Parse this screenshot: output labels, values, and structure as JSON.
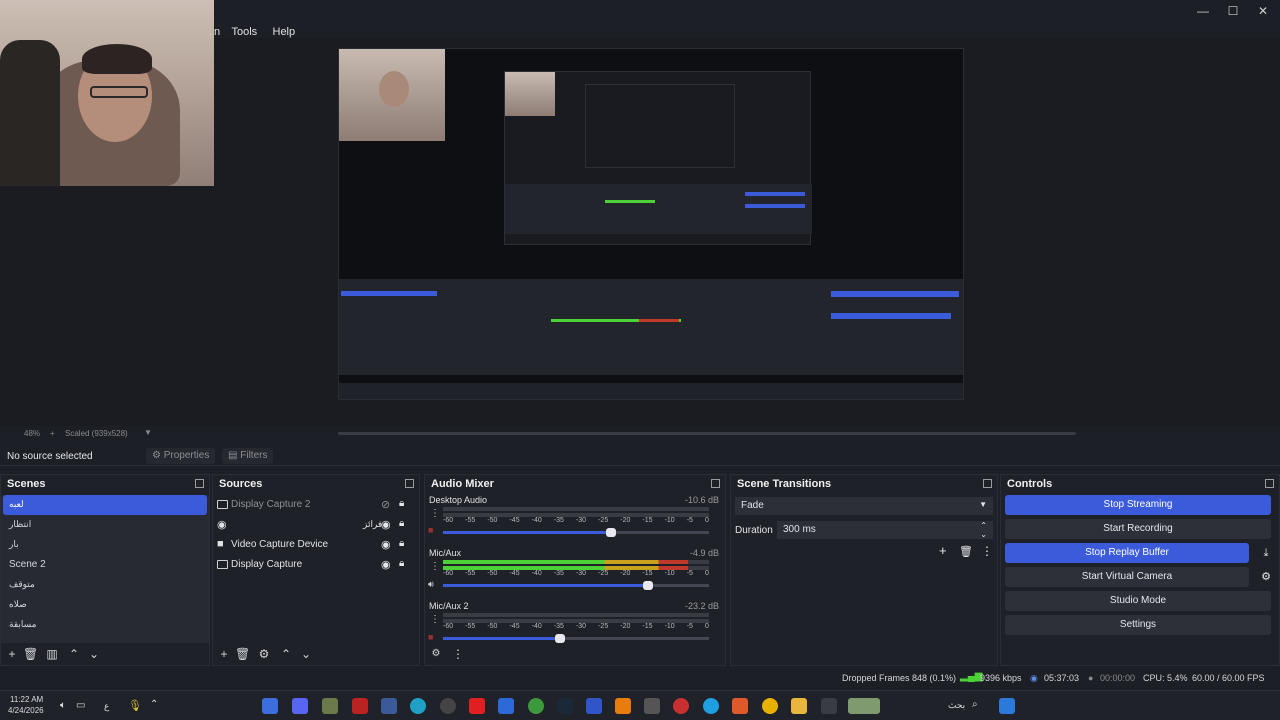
{
  "menu": {
    "tools": "Tools",
    "help": "Help",
    "partial": "n"
  },
  "window_controls": {
    "minimize": "—",
    "maximize": "☐",
    "close": "✕"
  },
  "preview": {
    "zoom": "48%",
    "scale_label": "Scaled (939x528)"
  },
  "source_toolbar": {
    "no_source": "No source selected",
    "properties": "Properties",
    "filters": "Filters"
  },
  "scenes": {
    "title": "Scenes",
    "items": [
      {
        "label": "لعبه",
        "selected": true
      },
      {
        "label": "انتظار",
        "selected": false
      },
      {
        "label": "بار",
        "selected": false
      },
      {
        "label": "Scene 2",
        "selected": false
      },
      {
        "label": "متوقف",
        "selected": false
      },
      {
        "label": "صلاه",
        "selected": false
      },
      {
        "label": "مسابقة",
        "selected": false
      }
    ]
  },
  "sources": {
    "title": "Sources",
    "items": [
      {
        "label": "Display Capture 2",
        "dimmed": true
      },
      {
        "label": "فرائز",
        "dimmed": false
      },
      {
        "label": "Video Capture Device",
        "dimmed": false
      },
      {
        "label": "Display Capture",
        "dimmed": false
      }
    ]
  },
  "audio_mixer": {
    "title": "Audio Mixer",
    "scale": [
      "-60",
      "-55",
      "-50",
      "-45",
      "-40",
      "-35",
      "-30",
      "-25",
      "-20",
      "-15",
      "-10",
      "-5",
      "0"
    ],
    "channels": [
      {
        "name": "Desktop Audio",
        "db": "-10.6 dB",
        "level": 0.0,
        "volume": 0.63
      },
      {
        "name": "Mic/Aux",
        "db": "-4.9 dB",
        "level": 0.92,
        "volume": 0.77
      },
      {
        "name": "Mic/Aux 2",
        "db": "-23.2 dB",
        "level": 0.0,
        "volume": 0.44
      }
    ]
  },
  "scene_transitions": {
    "title": "Scene Transitions",
    "transition": "Fade",
    "duration_label": "Duration",
    "duration_value": "300 ms"
  },
  "controls": {
    "title": "Controls",
    "stop_streaming": "Stop Streaming",
    "start_recording": "Start Recording",
    "stop_replay": "Stop Replay Buffer",
    "start_virtual_cam": "Start Virtual Camera",
    "studio_mode": "Studio Mode",
    "settings": "Settings"
  },
  "status": {
    "dropped_frames": "Dropped Frames 848 (0.1%)",
    "bitrate": "9396 kbps",
    "stream_time": "05:37:03",
    "rec_time": "00:00:00",
    "cpu": "CPU: 5.4%",
    "fps": "60.00 / 60.00 FPS"
  },
  "taskbar": {
    "time": "11:22 AM",
    "date": "4/24/2026",
    "search": "بحث",
    "lang": "ع"
  },
  "colors": {
    "accent": "#3b5bdb",
    "meter_green": "#4cd137",
    "meter_yellow": "#c7a21b",
    "meter_red": "#c0392b"
  }
}
